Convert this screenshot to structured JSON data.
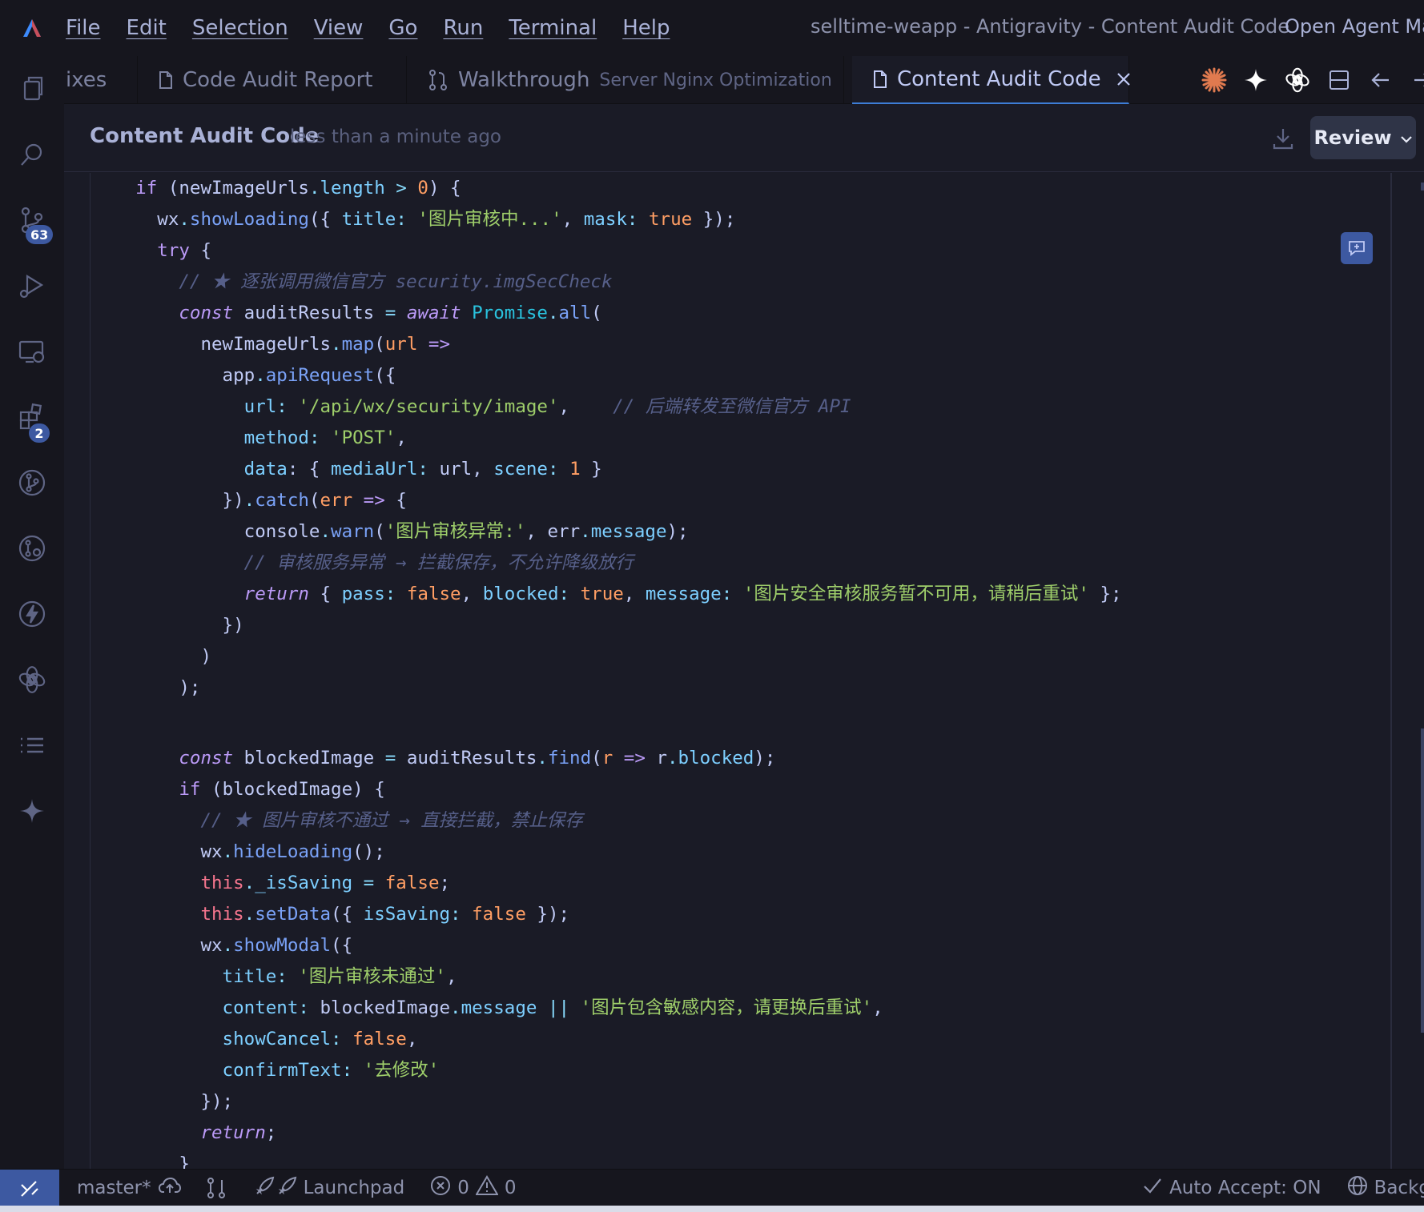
{
  "menu": [
    "File",
    "Edit",
    "Selection",
    "View",
    "Go",
    "Run",
    "Terminal",
    "Help"
  ],
  "window_title": "selltime-weapp - Antigravity - Content Audit Code",
  "agent_manager_label": "Open Agent Mar",
  "activity": {
    "source_control_badge": "63",
    "extensions_badge": "2"
  },
  "tabs": [
    {
      "label": "ixes",
      "desc": ""
    },
    {
      "label": "Code Audit Report",
      "desc": ""
    },
    {
      "label": "Walkthrough",
      "desc": "Server Nginx Optimization"
    },
    {
      "label": "Content Audit Code",
      "desc": ""
    }
  ],
  "header": {
    "title": "Content Audit Code",
    "time": "less than a minute ago",
    "review_label": "Review"
  },
  "code_lines": [
    [
      [
        "    if ",
        "k"
      ],
      [
        "(",
        "v"
      ],
      [
        "newImageUrls",
        "v"
      ],
      [
        ".",
        "op"
      ],
      [
        "length",
        "p"
      ],
      [
        " > ",
        "op"
      ],
      [
        "0",
        "n"
      ],
      [
        ") {",
        "v"
      ]
    ],
    [
      [
        "      wx",
        "v"
      ],
      [
        ".",
        "op"
      ],
      [
        "showLoading",
        "f"
      ],
      [
        "({ ",
        "v"
      ],
      [
        "title",
        "p"
      ],
      [
        ": ",
        "op"
      ],
      [
        "'图片审核中...'",
        "s"
      ],
      [
        ", ",
        "v"
      ],
      [
        "mask",
        "p"
      ],
      [
        ": ",
        "op"
      ],
      [
        "true",
        "b"
      ],
      [
        " });",
        "v"
      ]
    ],
    [
      [
        "      try",
        "k"
      ],
      [
        " {",
        "v"
      ]
    ],
    [
      [
        "        // ★ 逐张调用微信官方 security.imgSecCheck",
        "c"
      ]
    ],
    [
      [
        "        const",
        "ki"
      ],
      [
        " auditResults ",
        "v"
      ],
      [
        "= ",
        "op"
      ],
      [
        "await",
        "ki"
      ],
      [
        " ",
        "v"
      ],
      [
        "Promise",
        "fb"
      ],
      [
        ".",
        "op"
      ],
      [
        "all",
        "f"
      ],
      [
        "(",
        "v"
      ]
    ],
    [
      [
        "          newImageUrls",
        "v"
      ],
      [
        ".",
        "op"
      ],
      [
        "map",
        "f"
      ],
      [
        "(",
        "v"
      ],
      [
        "url",
        "n"
      ],
      [
        " =>",
        "k"
      ]
    ],
    [
      [
        "            app",
        "v"
      ],
      [
        ".",
        "op"
      ],
      [
        "apiRequest",
        "f"
      ],
      [
        "({",
        "v"
      ]
    ],
    [
      [
        "              url",
        "p"
      ],
      [
        ": ",
        "op"
      ],
      [
        "'/api/wx/security/image'",
        "s"
      ],
      [
        ",    ",
        "v"
      ],
      [
        "// 后端转发至微信官方 API",
        "c"
      ]
    ],
    [
      [
        "              method",
        "p"
      ],
      [
        ": ",
        "op"
      ],
      [
        "'POST'",
        "s"
      ],
      [
        ",",
        "v"
      ]
    ],
    [
      [
        "              data",
        "p"
      ],
      [
        ": { ",
        "v"
      ],
      [
        "mediaUrl",
        "p"
      ],
      [
        ": ",
        "op"
      ],
      [
        "url",
        "v"
      ],
      [
        ", ",
        "v"
      ],
      [
        "scene",
        "p"
      ],
      [
        ": ",
        "op"
      ],
      [
        "1",
        "n"
      ],
      [
        " }",
        "v"
      ]
    ],
    [
      [
        "            })",
        "v"
      ],
      [
        ".",
        "op"
      ],
      [
        "catch",
        "f"
      ],
      [
        "(",
        "v"
      ],
      [
        "err",
        "n"
      ],
      [
        " => ",
        "k"
      ],
      [
        "{",
        "v"
      ]
    ],
    [
      [
        "              console",
        "v"
      ],
      [
        ".",
        "op"
      ],
      [
        "warn",
        "f"
      ],
      [
        "(",
        "v"
      ],
      [
        "'图片审核异常:'",
        "s"
      ],
      [
        ", ",
        "v"
      ],
      [
        "err",
        "v"
      ],
      [
        ".",
        "op"
      ],
      [
        "message",
        "p"
      ],
      [
        ");",
        "v"
      ]
    ],
    [
      [
        "              // 审核服务异常 → 拦截保存，不允许降级放行",
        "c"
      ]
    ],
    [
      [
        "              return",
        "ki"
      ],
      [
        " { ",
        "v"
      ],
      [
        "pass",
        "p"
      ],
      [
        ": ",
        "op"
      ],
      [
        "false",
        "b"
      ],
      [
        ", ",
        "v"
      ],
      [
        "blocked",
        "p"
      ],
      [
        ": ",
        "op"
      ],
      [
        "true",
        "b"
      ],
      [
        ", ",
        "v"
      ],
      [
        "message",
        "p"
      ],
      [
        ": ",
        "op"
      ],
      [
        "'图片安全审核服务暂不可用，请稍后重试'",
        "s"
      ],
      [
        " };",
        "v"
      ]
    ],
    [
      [
        "            })",
        "v"
      ]
    ],
    [
      [
        "          )",
        "v"
      ]
    ],
    [
      [
        "        );",
        "v"
      ]
    ],
    [
      [
        "",
        "v"
      ]
    ],
    [
      [
        "        const",
        "ki"
      ],
      [
        " blockedImage ",
        "v"
      ],
      [
        "= ",
        "op"
      ],
      [
        "auditResults",
        "v"
      ],
      [
        ".",
        "op"
      ],
      [
        "find",
        "f"
      ],
      [
        "(",
        "v"
      ],
      [
        "r",
        "n"
      ],
      [
        " => ",
        "k"
      ],
      [
        "r",
        "v"
      ],
      [
        ".",
        "op"
      ],
      [
        "blocked",
        "p"
      ],
      [
        ");",
        "v"
      ]
    ],
    [
      [
        "        if",
        "k"
      ],
      [
        " (",
        "v"
      ],
      [
        "blockedImage",
        "v"
      ],
      [
        ") {",
        "v"
      ]
    ],
    [
      [
        "          // ★ 图片审核不通过 → 直接拦截，禁止保存",
        "c"
      ]
    ],
    [
      [
        "          wx",
        "v"
      ],
      [
        ".",
        "op"
      ],
      [
        "hideLoading",
        "f"
      ],
      [
        "();",
        "v"
      ]
    ],
    [
      [
        "          this",
        "this"
      ],
      [
        ".",
        "op"
      ],
      [
        "_isSaving",
        "p"
      ],
      [
        " = ",
        "op"
      ],
      [
        "false",
        "b"
      ],
      [
        ";",
        "v"
      ]
    ],
    [
      [
        "          this",
        "this"
      ],
      [
        ".",
        "op"
      ],
      [
        "setData",
        "f"
      ],
      [
        "({ ",
        "v"
      ],
      [
        "isSaving",
        "p"
      ],
      [
        ": ",
        "op"
      ],
      [
        "false",
        "b"
      ],
      [
        " });",
        "v"
      ]
    ],
    [
      [
        "          wx",
        "v"
      ],
      [
        ".",
        "op"
      ],
      [
        "showModal",
        "f"
      ],
      [
        "({",
        "v"
      ]
    ],
    [
      [
        "            title",
        "p"
      ],
      [
        ": ",
        "op"
      ],
      [
        "'图片审核未通过'",
        "s"
      ],
      [
        ",",
        "v"
      ]
    ],
    [
      [
        "            content",
        "p"
      ],
      [
        ": ",
        "op"
      ],
      [
        "blockedImage",
        "v"
      ],
      [
        ".",
        "op"
      ],
      [
        "message",
        "p"
      ],
      [
        " || ",
        "op"
      ],
      [
        "'图片包含敏感内容，请更换后重试'",
        "s"
      ],
      [
        ",",
        "v"
      ]
    ],
    [
      [
        "            showCancel",
        "p"
      ],
      [
        ": ",
        "op"
      ],
      [
        "false",
        "b"
      ],
      [
        ",",
        "v"
      ]
    ],
    [
      [
        "            confirmText",
        "p"
      ],
      [
        ": ",
        "op"
      ],
      [
        "'去修改'",
        "s"
      ]
    ],
    [
      [
        "          });",
        "v"
      ]
    ],
    [
      [
        "          return",
        "ki"
      ],
      [
        ";",
        "v"
      ]
    ],
    [
      [
        "        }",
        "v"
      ]
    ]
  ],
  "status": {
    "branch": "master*",
    "launchpad": "Launchpad",
    "errors": "0",
    "warnings": "0",
    "auto_accept": "Auto Accept: ON",
    "background": "Backg"
  },
  "colors": {
    "accent": "#3d59a1",
    "background": "#1a1b26",
    "chrome": "#16161e"
  }
}
